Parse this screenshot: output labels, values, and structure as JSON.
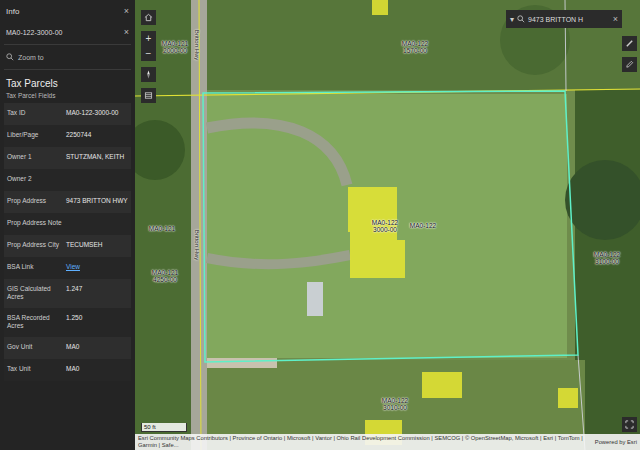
{
  "panel": {
    "title": "Info",
    "close": "×",
    "feature": "MA0-122-3000-00",
    "feature_clear": "×",
    "zoom": "Zoom to",
    "layer": "Tax Parcels",
    "subtitle": "Tax Parcel Fields",
    "fields": [
      {
        "label": "Tax ID",
        "value": "MA0-122-3000-00",
        "kind": "text"
      },
      {
        "label": "Liber/Page",
        "value": "2250744",
        "kind": "text"
      },
      {
        "label": "Owner 1",
        "value": "STUTZMAN, KEITH",
        "kind": "text"
      },
      {
        "label": "Owner 2",
        "value": "",
        "kind": "text"
      },
      {
        "label": "Prop Address",
        "value": "9473 BRITTON HWY",
        "kind": "text"
      },
      {
        "label": "Prop Address Note",
        "value": "",
        "kind": "text"
      },
      {
        "label": "Prop Address City",
        "value": "TECUMSEH",
        "kind": "text"
      },
      {
        "label": "BSA Link",
        "value": "View",
        "kind": "link"
      },
      {
        "label": "GIS Calculated Acres",
        "value": "1.247",
        "kind": "text"
      },
      {
        "label": "BSA Recorded Acres",
        "value": "1.250",
        "kind": "text"
      },
      {
        "label": "Gov Unit",
        "value": "MA0",
        "kind": "text"
      },
      {
        "label": "Tax Unit",
        "value": "MA0",
        "kind": "text"
      }
    ]
  },
  "map": {
    "search": {
      "dropdown": "▾",
      "value": "9473 BRITTON H",
      "clear": "×"
    },
    "zoom_in": "+",
    "zoom_out": "−",
    "road_labels": [
      "Britton Hwy",
      "Britton Hwy"
    ],
    "parcel_labels": [
      {
        "lines": [
          "MA0-121",
          "2000-00"
        ]
      },
      {
        "lines": [
          "MA0-122",
          "1570-00"
        ]
      },
      {
        "lines": [
          "MA0-121"
        ]
      },
      {
        "lines": [
          "MA0-121",
          "4250-00"
        ]
      },
      {
        "lines": [
          "MA0-122",
          "3000-00"
        ]
      },
      {
        "lines": [
          "MA0-122"
        ]
      },
      {
        "lines": [
          "MA0-122",
          "3100-00"
        ]
      },
      {
        "lines": [
          "MA0-122",
          "3010-00"
        ]
      }
    ],
    "scale": "50 ft",
    "attribution": "Esri Community Maps Contributors | Province of Ontario | Microsoft | Vantor | Ohio Rail Development Commission | SEMCOG | © OpenStreetMap, Microsoft | Esri | TomTom | Garmin | Safe...",
    "powered": "Powered by Esri"
  }
}
